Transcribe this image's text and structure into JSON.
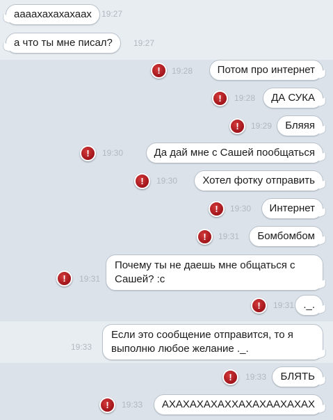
{
  "colors": {
    "error_red": "#b21a20",
    "bubble_bg": "#ffffff",
    "background": "#dbe2ea",
    "highlight_row": "#e8edf2"
  },
  "error_icon": {
    "name": "exclamation-circle-icon",
    "glyph": "!"
  },
  "messages": [
    {
      "text": "аааахахахахаах",
      "time": "19:27"
    },
    {
      "text": "а что ты мне писал?",
      "time": "19:27"
    },
    {
      "text": "Потом про интернет",
      "time": "19:28"
    },
    {
      "text": "ДА СУКА",
      "time": "19:28"
    },
    {
      "text": "Бляяя",
      "time": "19:29"
    },
    {
      "text": "Да дай мне с Сашей пообщаться",
      "time": "19:30"
    },
    {
      "text": "Хотел фотку отправить",
      "time": "19:30"
    },
    {
      "text": "Интернет",
      "time": "19:30"
    },
    {
      "text": "Бомбомбом",
      "time": "19:31"
    },
    {
      "text": "Почему ты не даешь мне общаться с Сашей? :с",
      "time": "19:31"
    },
    {
      "text": "._.",
      "time": "19:31"
    },
    {
      "text": "Если это сообщение отправится, то я выполню любое желание ._.",
      "time": "19:33"
    },
    {
      "text": "БЛЯТЬ",
      "time": "19:33"
    },
    {
      "text": "АХАХАХАХАХХАХАХААХАХАХ",
      "time": "19:33"
    }
  ]
}
